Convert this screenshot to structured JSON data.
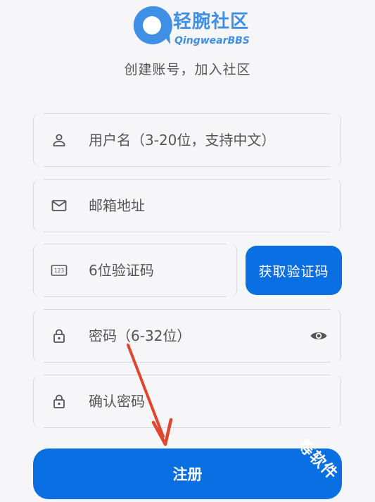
{
  "app": {
    "name": "轻腕社区",
    "subname": "QingwearBBS",
    "subtitle": "创建账号，加入社区"
  },
  "form": {
    "username_placeholder": "用户名（3-20位，支持中文）",
    "email_placeholder": "邮箱地址",
    "code_placeholder": "6位验证码",
    "get_code_label": "获取验证码",
    "password_placeholder": "密码（6-32位）",
    "confirm_placeholder": "确认密码",
    "register_label": "注册"
  },
  "overlay": {
    "watermark_text": "等软件"
  },
  "colors": {
    "primary": "#0a6fe3",
    "logo": "#3f8fe4",
    "annotation_arrow": "#e0452e"
  },
  "icons": {
    "username": "person-icon",
    "email": "mail-icon",
    "code": "numeric-keypad-icon",
    "password": "lock-icon",
    "confirm": "lock-icon",
    "visibility": "eye-icon"
  }
}
